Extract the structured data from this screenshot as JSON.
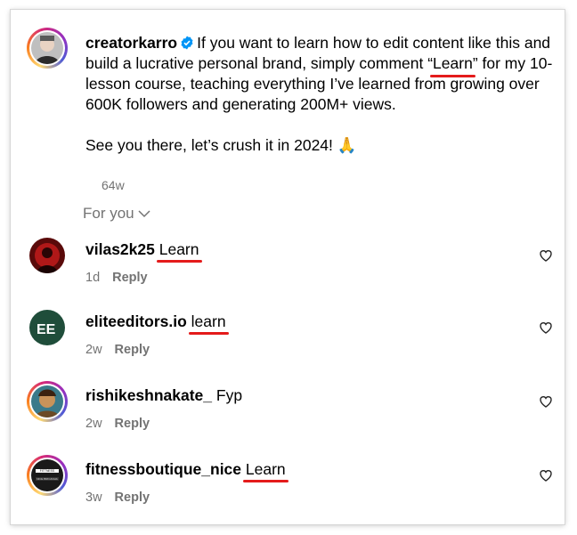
{
  "post": {
    "username": "creatorkarro",
    "verified": true,
    "caption_before": "If you want to learn how to edit content like this and build a lucrative personal brand, simply comment “",
    "caption_keyword": "Learn",
    "caption_after": "” for my 10-lesson course, teaching everything I’ve learned from growing over 600K followers and generating 200M+ views.",
    "caption_line2": "See you there, let’s crush it in 2024! 🙏",
    "time": "64w"
  },
  "filter": {
    "label": "For you"
  },
  "comments": [
    {
      "username": "vilas2k25",
      "text": "Learn",
      "time": "1d",
      "reply": "Reply",
      "underline": true
    },
    {
      "username": "eliteeditors.io",
      "text": "learn",
      "time": "2w",
      "reply": "Reply",
      "underline": true
    },
    {
      "username": "rishikeshnakate_",
      "text": "Fyp",
      "time": "2w",
      "reply": "Reply",
      "underline": false
    },
    {
      "username": "fitnessboutique_nice",
      "text": "Learn",
      "time": "3w",
      "reply": "Reply",
      "underline": true
    }
  ],
  "avatars": {
    "fitness_line1": "FITTNESS",
    "fitness_line2": "NICE BRICANHA"
  },
  "colors": {
    "underline": "#e41b1b",
    "muted": "#737373",
    "verified": "#0095f6"
  }
}
